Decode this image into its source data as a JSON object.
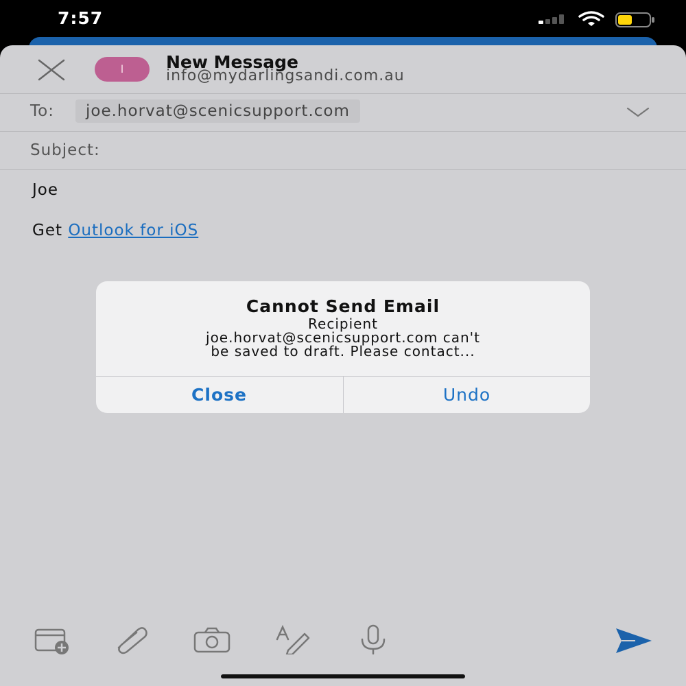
{
  "status_bar": {
    "time": "7:57",
    "signal_icon": "cellular-signal-icon",
    "signal_bars": 4,
    "signal_bars_active": 1,
    "wifi_icon": "wifi-icon",
    "battery_icon": "battery-icon",
    "battery_color": "#ffd60a",
    "battery_level": 0.45
  },
  "compose": {
    "close_icon": "close-icon",
    "avatar_initial": "I",
    "avatar_color": "#bd5f91",
    "title": "New Message",
    "from": "info@mydarlingsandi.com.au",
    "to_label": "To:",
    "to_recipient": "joe.horvat@scenicsupport.com",
    "expand_icon": "chevron-down-icon",
    "subject_label": "Subject:",
    "subject_value": "",
    "body_greeting": "Joe",
    "signature_prefix": "Get",
    "signature_link": "Outlook for iOS",
    "link_color": "#1a6dbf"
  },
  "toolbar": {
    "items": [
      {
        "name": "calendar-add-icon",
        "interactable": true
      },
      {
        "name": "paperclip-icon",
        "interactable": true
      },
      {
        "name": "camera-icon",
        "interactable": true
      },
      {
        "name": "format-text-icon",
        "interactable": true
      },
      {
        "name": "microphone-icon",
        "interactable": true
      },
      {
        "name": "send-icon",
        "interactable": true
      }
    ],
    "send_color": "#1b62ab"
  },
  "alert": {
    "title": "Cannot Send Email",
    "message_line1": "Recipient",
    "message_line2": "joe.horvat@scenicsupport.com can't",
    "message_line3": "be saved to draft. Please contact...",
    "close_label": "Close",
    "undo_label": "Undo",
    "button_color": "#1d72c5"
  }
}
